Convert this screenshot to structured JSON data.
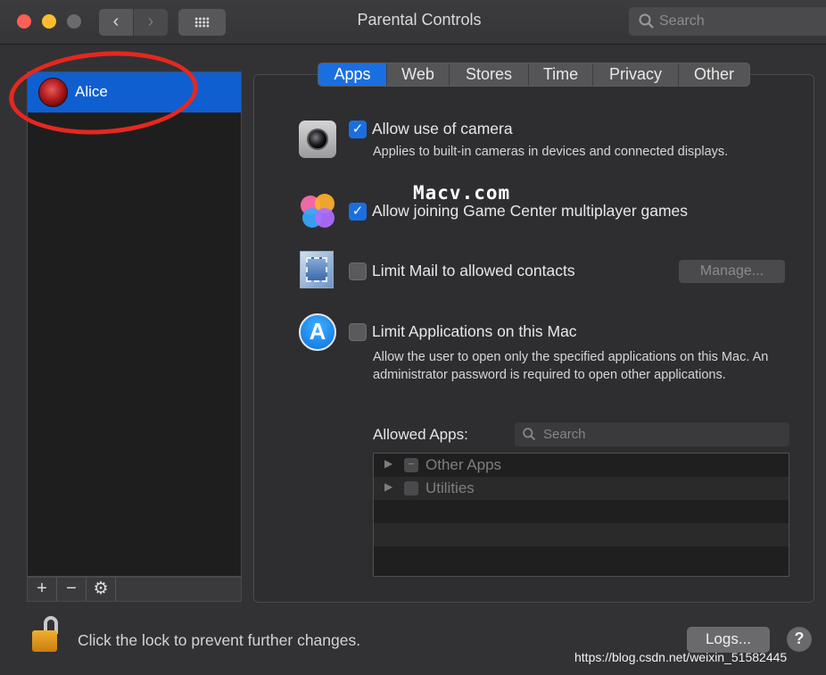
{
  "window": {
    "title": "Parental Controls",
    "search_placeholder": "Search"
  },
  "nav": {
    "back_icon": "chevron-left",
    "forward_icon": "chevron-right",
    "show_all_icon": "grid"
  },
  "users": [
    {
      "name": "Alice",
      "selected": true
    }
  ],
  "list_toolbar": {
    "add": "+",
    "remove": "−",
    "gear": "⚙"
  },
  "tabs": [
    {
      "label": "Apps",
      "active": true
    },
    {
      "label": "Web",
      "active": false
    },
    {
      "label": "Stores",
      "active": false
    },
    {
      "label": "Time",
      "active": false
    },
    {
      "label": "Privacy",
      "active": false
    },
    {
      "label": "Other",
      "active": false
    }
  ],
  "settings": {
    "camera": {
      "label": "Allow use of camera",
      "checked": true,
      "description": "Applies to built-in cameras in devices and connected displays."
    },
    "game_center": {
      "label": "Allow joining Game Center multiplayer games",
      "checked": true
    },
    "mail": {
      "label": "Limit Mail to allowed contacts",
      "checked": false,
      "manage_label": "Manage..."
    },
    "apps": {
      "label": "Limit Applications on this Mac",
      "checked": false,
      "description": "Allow the user to open only the specified applications on this Mac. An administrator password is required to open other applications."
    }
  },
  "allowed_apps": {
    "label": "Allowed Apps:",
    "search_placeholder": "Search",
    "rows": [
      {
        "label": "Other Apps",
        "mark": "−"
      },
      {
        "label": "Utilities",
        "mark": ""
      }
    ]
  },
  "footer": {
    "lock_text": "Click the lock to prevent further changes.",
    "logs_label": "Logs...",
    "help_label": "?"
  },
  "overlay": {
    "watermark": "Macv.com",
    "credit": "https://blog.csdn.net/weixin_51582445"
  },
  "colors": {
    "accent": "#1a6fe0",
    "selection": "#0f5fd1",
    "annotation_ring": "#e5281f"
  }
}
